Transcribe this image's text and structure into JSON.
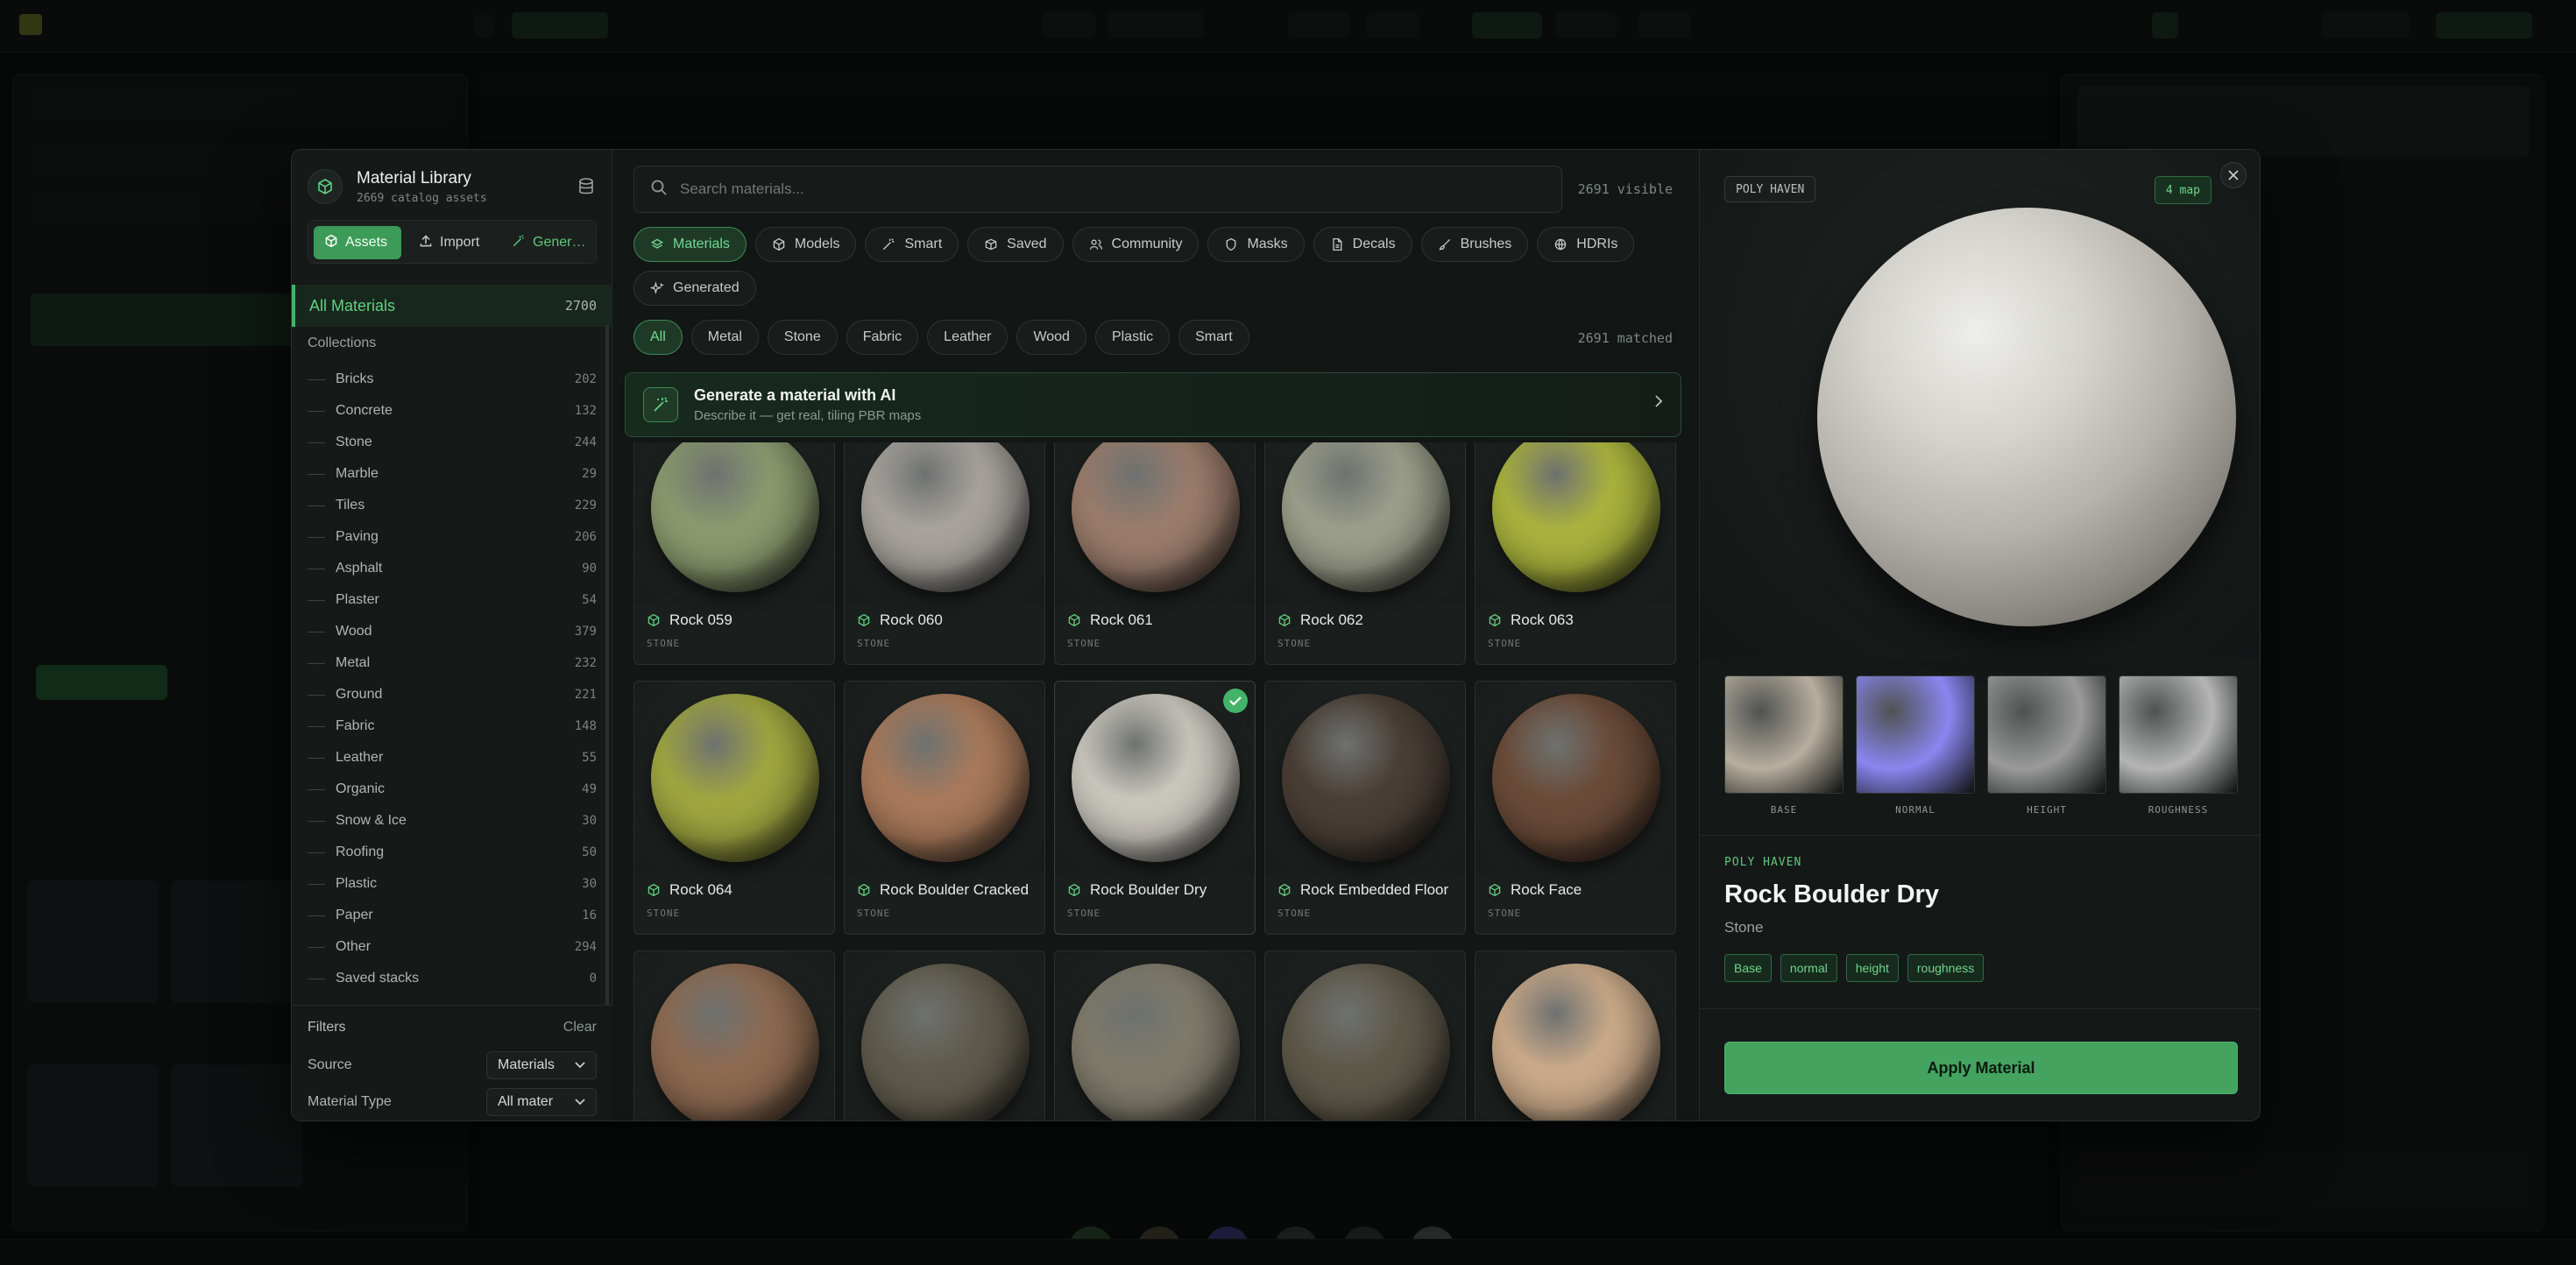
{
  "library": {
    "title": "Material Library",
    "subtitle": "2669 catalog assets",
    "tabs": [
      {
        "label": "Assets",
        "icon": "cube-icon"
      },
      {
        "label": "Import",
        "icon": "upload-icon"
      },
      {
        "label": "Gener…",
        "icon": "wand-icon"
      }
    ],
    "all_label": "All Materials",
    "all_count": "2700",
    "collections_label": "Collections",
    "collections": [
      {
        "label": "Bricks",
        "count": "202"
      },
      {
        "label": "Concrete",
        "count": "132"
      },
      {
        "label": "Stone",
        "count": "244"
      },
      {
        "label": "Marble",
        "count": "29"
      },
      {
        "label": "Tiles",
        "count": "229"
      },
      {
        "label": "Paving",
        "count": "206"
      },
      {
        "label": "Asphalt",
        "count": "90"
      },
      {
        "label": "Plaster",
        "count": "54"
      },
      {
        "label": "Wood",
        "count": "379"
      },
      {
        "label": "Metal",
        "count": "232"
      },
      {
        "label": "Ground",
        "count": "221"
      },
      {
        "label": "Fabric",
        "count": "148"
      },
      {
        "label": "Leather",
        "count": "55"
      },
      {
        "label": "Organic",
        "count": "49"
      },
      {
        "label": "Snow & Ice",
        "count": "30"
      },
      {
        "label": "Roofing",
        "count": "50"
      },
      {
        "label": "Plastic",
        "count": "30"
      },
      {
        "label": "Paper",
        "count": "16"
      },
      {
        "label": "Other",
        "count": "294"
      },
      {
        "label": "Saved stacks",
        "count": "0"
      }
    ],
    "filters": {
      "title": "Filters",
      "clear": "Clear",
      "source_label": "Source",
      "source_value": "Materials",
      "type_label": "Material Type",
      "type_value": "All mater"
    }
  },
  "search": {
    "placeholder": "Search materials...",
    "visible": "2691 visible"
  },
  "types": [
    {
      "label": "Materials",
      "icon": "layers-icon"
    },
    {
      "label": "Models",
      "icon": "model-icon"
    },
    {
      "label": "Smart",
      "icon": "wand-icon"
    },
    {
      "label": "Saved",
      "icon": "box-icon"
    },
    {
      "label": "Community",
      "icon": "users-icon"
    },
    {
      "label": "Masks",
      "icon": "shield-icon"
    },
    {
      "label": "Decals",
      "icon": "decal-icon"
    },
    {
      "label": "Brushes",
      "icon": "brush-icon"
    },
    {
      "label": "HDRIs",
      "icon": "globe-icon"
    },
    {
      "label": "Generated",
      "icon": "sparkle-icon"
    }
  ],
  "categories": [
    "All",
    "Metal",
    "Stone",
    "Fabric",
    "Leather",
    "Wood",
    "Plastic",
    "Smart"
  ],
  "matched": "2691 matched",
  "generate": {
    "title": "Generate a material with AI",
    "subtitle": "Describe it — get real, tiling PBR maps"
  },
  "materials": [
    {
      "name": "Rock 059",
      "category": "STONE",
      "color": "#8a9a6e"
    },
    {
      "name": "Rock 060",
      "category": "STONE",
      "color": "#a7a39c"
    },
    {
      "name": "Rock 061",
      "category": "STONE",
      "color": "#9a7c6b"
    },
    {
      "name": "Rock 062",
      "category": "STONE",
      "color": "#9b9e8a"
    },
    {
      "name": "Rock 063",
      "category": "STONE",
      "color": "#a9b23d"
    },
    {
      "name": "Rock 064",
      "category": "STONE",
      "color": "#9fa640"
    },
    {
      "name": "Rock Boulder Cracked",
      "category": "STONE",
      "color": "#a8795a"
    },
    {
      "name": "Rock Boulder Dry",
      "category": "STONE",
      "color": "#c9c6bd"
    },
    {
      "name": "Rock Embedded Floor",
      "category": "STONE",
      "color": "#4a3f36"
    },
    {
      "name": "Rock Face",
      "category": "STONE",
      "color": "#6a4b38"
    },
    {
      "name": "",
      "category": "",
      "color": "#8d6a51"
    },
    {
      "name": "",
      "category": "",
      "color": "#5f5a4c"
    },
    {
      "name": "",
      "category": "",
      "color": "#7f7a6a"
    },
    {
      "name": "",
      "category": "",
      "color": "#5e5849"
    },
    {
      "name": "",
      "category": "",
      "color": "#c9a989"
    }
  ],
  "selected_index": 7,
  "preview": {
    "badge": "POLY HAVEN",
    "maps_count": "4 map",
    "maps": [
      {
        "label": "BASE",
        "color": "#b7ae9e"
      },
      {
        "label": "NORMAL",
        "color": "#8a86f0"
      },
      {
        "label": "HEIGHT",
        "color": "#9a9a9a"
      },
      {
        "label": "ROUGHNESS",
        "color": "#b5b5b5"
      }
    ],
    "source": "POLY HAVEN",
    "name": "Rock Boulder Dry",
    "category": "Stone",
    "tags": [
      "Base",
      "normal",
      "height",
      "roughness"
    ],
    "apply": "Apply Material"
  },
  "colors": {
    "accent": "#43b36a",
    "accent_fill": "#3c9b58"
  }
}
